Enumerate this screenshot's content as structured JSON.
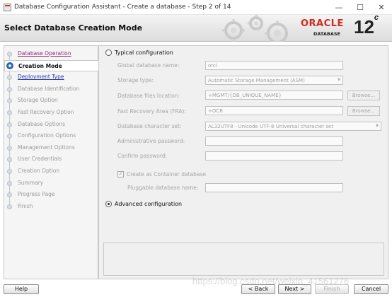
{
  "window": {
    "title": "Database Configuration Assistant - Create a database - Step 2 of 14",
    "minimize_glyph": "—",
    "maximize_glyph": "☐",
    "close_glyph": "✕"
  },
  "header": {
    "page_title": "Select Database Creation Mode",
    "logo_oracle": "ORACLE",
    "logo_database": "DATABASE",
    "logo_version": "12",
    "logo_version_suffix": "c"
  },
  "steps": [
    {
      "label": "Database Operation",
      "state": "done"
    },
    {
      "label": "Creation Mode",
      "state": "current"
    },
    {
      "label": "Deployment Type",
      "state": "link"
    },
    {
      "label": "Database Identification",
      "state": "pending"
    },
    {
      "label": "Storage Option",
      "state": "pending"
    },
    {
      "label": "Fast Recovery Option",
      "state": "pending"
    },
    {
      "label": "Database Options",
      "state": "pending"
    },
    {
      "label": "Configuration Options",
      "state": "pending"
    },
    {
      "label": "Management Options",
      "state": "pending"
    },
    {
      "label": "User Credentials",
      "state": "pending"
    },
    {
      "label": "Creation Option",
      "state": "pending"
    },
    {
      "label": "Summary",
      "state": "pending"
    },
    {
      "label": "Progress Page",
      "state": "pending"
    },
    {
      "label": "Finish",
      "state": "pending"
    }
  ],
  "typical": {
    "label": "Typical configuration",
    "checked": false,
    "global_db_name_label": "Global database name:",
    "global_db_name_value": "orcl",
    "storage_type_label": "Storage type:",
    "storage_type_value": "Automatic Storage Management (ASM)",
    "db_files_location_label": "Database files location:",
    "db_files_location_value": "+MGMT/{DB_UNIQUE_NAME}",
    "fra_label": "Fast Recovery Area (FRA):",
    "fra_value": "+OCR",
    "charset_label": "Database character set:",
    "charset_value": "AL32UTF8 - Unicode UTF-8 Universal character set",
    "admin_password_label": "Administrative password:",
    "admin_password_value": "",
    "confirm_password_label": "Confirm password:",
    "confirm_password_value": "",
    "browse_label": "Browse...",
    "container_db_label": "Create as Container database",
    "container_db_checked": true,
    "pluggable_db_label": "Pluggable database name:",
    "pluggable_db_value": ""
  },
  "advanced": {
    "label": "Advanced configuration",
    "checked": true
  },
  "footer": {
    "help": "Help",
    "back": "< Back",
    "next": "Next >",
    "finish": "Finish",
    "cancel": "Cancel"
  },
  "watermark": "https://blog.csdn.net/weixin_41561276"
}
